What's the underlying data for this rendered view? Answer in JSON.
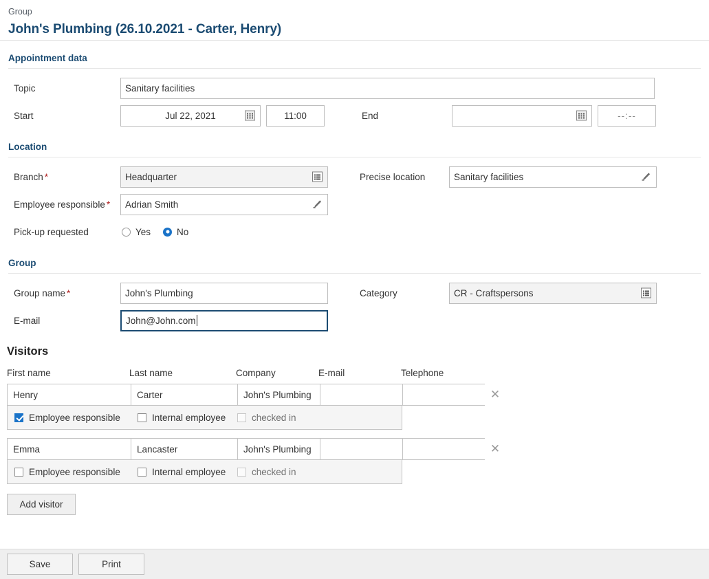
{
  "header": {
    "breadcrumb": "Group",
    "title": "John's Plumbing (26.10.2021 - Carter, Henry)"
  },
  "appointment": {
    "section_title": "Appointment data",
    "topic_label": "Topic",
    "topic_value": "Sanitary facilities",
    "start_label": "Start",
    "start_date": "Jul 22, 2021",
    "start_time": "11:00",
    "end_label": "End",
    "end_date": "",
    "end_time": "--:--",
    "calendar_icon": "calendar-icon"
  },
  "location": {
    "section_title": "Location",
    "branch_label": "Branch",
    "branch_value": "Headquarter",
    "precise_label": "Precise location",
    "precise_value": "Sanitary facilities",
    "employee_label": "Employee responsible",
    "employee_value": "Adrian Smith",
    "pickup_label": "Pick-up requested",
    "pickup_yes": "Yes",
    "pickup_no": "No",
    "pickup_selected": "No",
    "required_marker": "*"
  },
  "group": {
    "section_title": "Group",
    "name_label": "Group name",
    "name_value": "John's Plumbing",
    "category_label": "Category",
    "category_value": "CR - Craftspersons",
    "email_label": "E-mail",
    "email_value": "John@John.com"
  },
  "visitors": {
    "title": "Visitors",
    "columns": [
      "First name",
      "Last name",
      "Company",
      "E-mail",
      "Telephone"
    ],
    "option_labels": {
      "employee_responsible": "Employee responsible",
      "internal_employee": "Internal employee",
      "checked_in": "checked in"
    },
    "rows": [
      {
        "first_name": "Henry",
        "last_name": "Carter",
        "company": "John's Plumbing",
        "email": "",
        "telephone": "",
        "employee_responsible": true,
        "internal_employee": false,
        "checked_in": false,
        "delete_icon": "close-icon"
      },
      {
        "first_name": "Emma",
        "last_name": "Lancaster",
        "company": "John's Plumbing",
        "email": "",
        "telephone": "",
        "employee_responsible": false,
        "internal_employee": false,
        "checked_in": false,
        "delete_icon": "close-icon"
      }
    ],
    "add_button": "Add visitor"
  },
  "footer": {
    "save_label": "Save",
    "print_label": "Print"
  },
  "colors": {
    "accent": "#1b4b72",
    "selection": "#1a73c8",
    "required": "#b02020",
    "footer_bg": "#efefef"
  }
}
